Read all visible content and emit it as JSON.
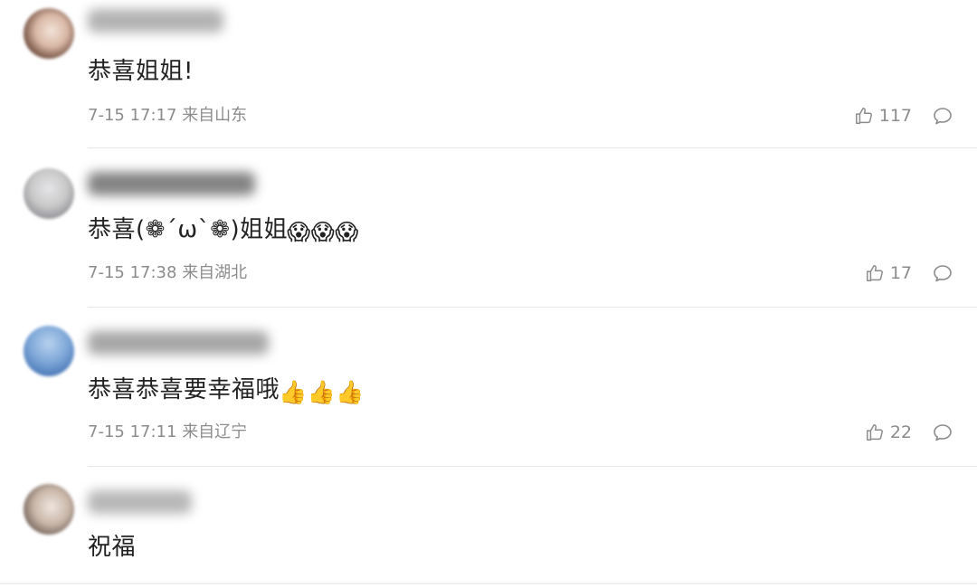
{
  "comments": [
    {
      "text": "恭喜姐姐!",
      "emojis": "",
      "time": "7-15 17:17",
      "location": "来自山东",
      "likes": "117",
      "avatar_colors": [
        "#6d4a3c",
        "#d9b8a6",
        "#f2e3d8"
      ],
      "username_color": "#9a9a9a"
    },
    {
      "text": "恭喜(❁´ω`❁)姐姐",
      "emojis": "😱😱😱",
      "time": "7-15 17:38",
      "location": "来自湖北",
      "likes": "17",
      "avatar_colors": [
        "#c9c9c9",
        "#8f8f95",
        "#e5e5e8"
      ],
      "username_color": "#5a5a5a"
    },
    {
      "text": "恭喜恭喜要幸福哦",
      "emojis": "👍👍👍",
      "time": "7-15 17:11",
      "location": "来自辽宁",
      "likes": "22",
      "avatar_colors": [
        "#7fa8d8",
        "#4b79b8",
        "#b7d1ee"
      ],
      "username_color": "#8a8a8a"
    },
    {
      "text": "祝福",
      "emojis": "",
      "time": "",
      "location": "",
      "likes": "",
      "avatar_colors": [
        "#6b5a52",
        "#c8b6a8",
        "#efe6df"
      ],
      "username_color": "#a0a0a0"
    }
  ],
  "icons": {
    "like": "thumbs-up-icon",
    "reply": "comment-bubble-icon"
  },
  "colors": {
    "text_primary": "#222222",
    "text_secondary": "#8c8c8c",
    "divider": "#e6e6e6"
  }
}
